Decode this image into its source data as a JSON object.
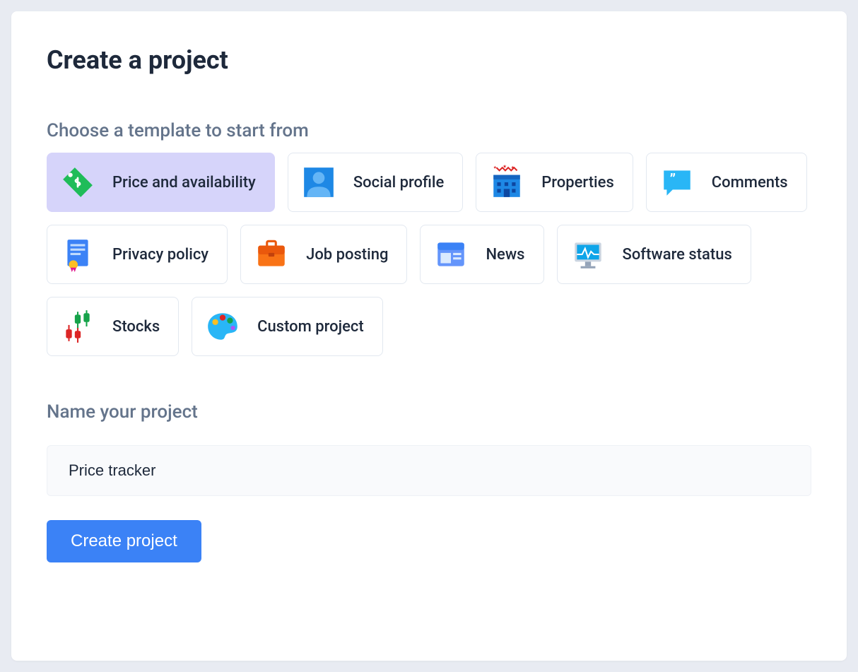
{
  "heading": "Create a project",
  "template_label": "Choose a template to start from",
  "templates": [
    {
      "id": "price-availability",
      "label": "Price and availability",
      "icon": "price-tag-icon",
      "selected": true
    },
    {
      "id": "social-profile",
      "label": "Social profile",
      "icon": "person-icon",
      "selected": false
    },
    {
      "id": "properties",
      "label": "Properties",
      "icon": "building-icon",
      "selected": false
    },
    {
      "id": "comments",
      "label": "Comments",
      "icon": "comment-icon",
      "selected": false
    },
    {
      "id": "privacy-policy",
      "label": "Privacy policy",
      "icon": "document-ribbon-icon",
      "selected": false
    },
    {
      "id": "job-posting",
      "label": "Job posting",
      "icon": "briefcase-icon",
      "selected": false
    },
    {
      "id": "news",
      "label": "News",
      "icon": "newspaper-icon",
      "selected": false
    },
    {
      "id": "software-status",
      "label": "Software status",
      "icon": "monitor-icon",
      "selected": false
    },
    {
      "id": "stocks",
      "label": "Stocks",
      "icon": "candlestick-icon",
      "selected": false
    },
    {
      "id": "custom-project",
      "label": "Custom project",
      "icon": "palette-icon",
      "selected": false
    }
  ],
  "name_label": "Name your project",
  "name_value": "Price tracker",
  "create_button": "Create project"
}
